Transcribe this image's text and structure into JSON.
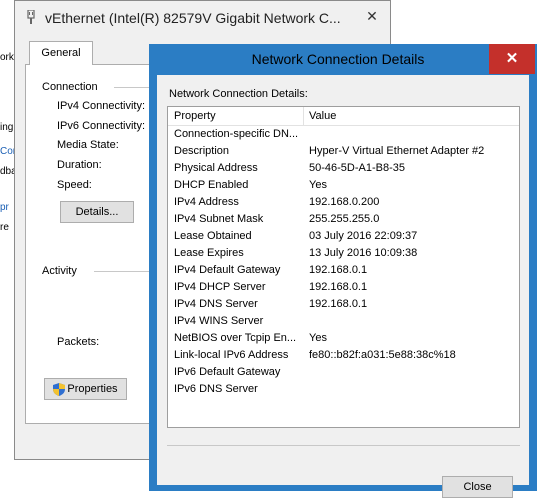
{
  "background_window": {
    "fragments": [
      "ork",
      "ing s",
      "Con",
      "dba",
      "pr",
      "re"
    ]
  },
  "status_window": {
    "title": "vEthernet (Intel(R) 82579V Gigabit Network C...",
    "close_label": "✕",
    "tab_general": "General",
    "connection": {
      "section": "Connection",
      "ipv4": "IPv4 Connectivity:",
      "ipv6": "IPv6 Connectivity:",
      "media": "Media State:",
      "duration": "Duration:",
      "speed": "Speed:",
      "details_button": "Details..."
    },
    "activity": {
      "section": "Activity",
      "packets": "Packets:"
    },
    "properties_button": "Properties"
  },
  "details_window": {
    "title": "Network Connection Details",
    "close_label": "✕",
    "caption": "Network Connection Details:",
    "columns": {
      "property": "Property",
      "value": "Value"
    },
    "rows": [
      {
        "property": "Connection-specific DN...",
        "value": ""
      },
      {
        "property": "Description",
        "value": "Hyper-V Virtual Ethernet Adapter #2"
      },
      {
        "property": "Physical Address",
        "value": "50-46-5D-A1-B8-35"
      },
      {
        "property": "DHCP Enabled",
        "value": "Yes"
      },
      {
        "property": "IPv4 Address",
        "value": "192.168.0.200"
      },
      {
        "property": "IPv4 Subnet Mask",
        "value": "255.255.255.0"
      },
      {
        "property": "Lease Obtained",
        "value": "03 July 2016 22:09:37"
      },
      {
        "property": "Lease Expires",
        "value": "13 July 2016 10:09:38"
      },
      {
        "property": "IPv4 Default Gateway",
        "value": "192.168.0.1"
      },
      {
        "property": "IPv4 DHCP Server",
        "value": "192.168.0.1"
      },
      {
        "property": "IPv4 DNS Server",
        "value": "192.168.0.1"
      },
      {
        "property": "IPv4 WINS Server",
        "value": ""
      },
      {
        "property": "NetBIOS over Tcpip En...",
        "value": "Yes"
      },
      {
        "property": "Link-local IPv6 Address",
        "value": "fe80::b82f:a031:5e88:38c%18"
      },
      {
        "property": "IPv6 Default Gateway",
        "value": ""
      },
      {
        "property": "IPv6 DNS Server",
        "value": ""
      }
    ],
    "close_button": "Close"
  },
  "colors": {
    "details_frame": "#2b7dc4",
    "close_red": "#c4302b"
  }
}
